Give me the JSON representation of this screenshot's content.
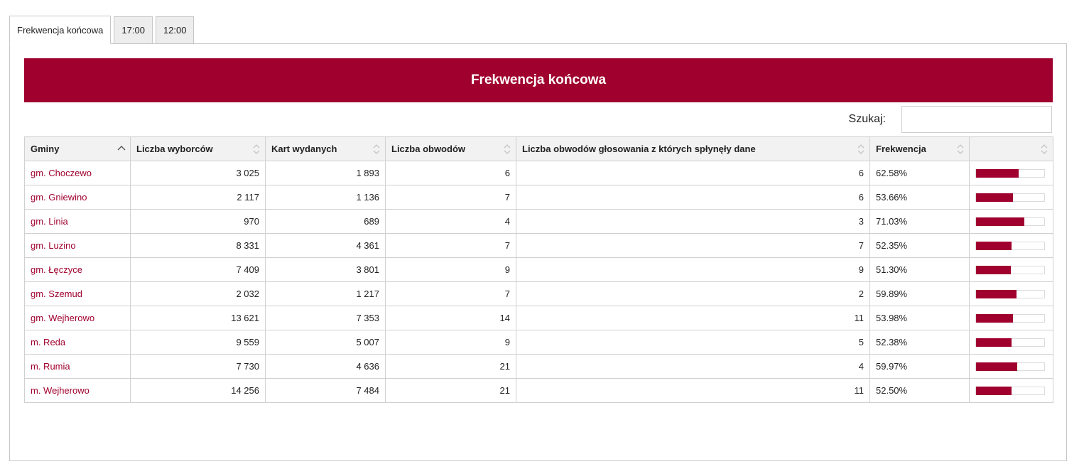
{
  "tabs": [
    {
      "label": "Frekwencja końcowa",
      "active": true
    },
    {
      "label": "17:00",
      "active": false
    },
    {
      "label": "12:00",
      "active": false
    }
  ],
  "banner_title": "Frekwencja końcowa",
  "search": {
    "label": "Szukaj:",
    "value": ""
  },
  "columns": [
    "Gminy",
    "Liczba wyborców",
    "Kart wydanych",
    "Liczba obwodów",
    "Liczba obwodów głosowania z których spłynęły dane",
    "Frekwencja",
    ""
  ],
  "sort": {
    "column": 0,
    "direction": "asc"
  },
  "colors": {
    "accent": "#a0002e",
    "header_bg": "#f2f2f2",
    "border": "#d0d0d0"
  },
  "rows": [
    {
      "name": "gm. Choczewo",
      "voters": "3 025",
      "cards": "1 893",
      "districts": "6",
      "reported": "6",
      "turnout": "62.58%",
      "turnout_value": 62.58
    },
    {
      "name": "gm. Gniewino",
      "voters": "2 117",
      "cards": "1 136",
      "districts": "7",
      "reported": "6",
      "turnout": "53.66%",
      "turnout_value": 53.66
    },
    {
      "name": "gm. Linia",
      "voters": "970",
      "cards": "689",
      "districts": "4",
      "reported": "3",
      "turnout": "71.03%",
      "turnout_value": 71.03
    },
    {
      "name": "gm. Luzino",
      "voters": "8 331",
      "cards": "4 361",
      "districts": "7",
      "reported": "7",
      "turnout": "52.35%",
      "turnout_value": 52.35
    },
    {
      "name": "gm. Łęczyce",
      "voters": "7 409",
      "cards": "3 801",
      "districts": "9",
      "reported": "9",
      "turnout": "51.30%",
      "turnout_value": 51.3
    },
    {
      "name": "gm. Szemud",
      "voters": "2 032",
      "cards": "1 217",
      "districts": "7",
      "reported": "2",
      "turnout": "59.89%",
      "turnout_value": 59.89
    },
    {
      "name": "gm. Wejherowo",
      "voters": "13 621",
      "cards": "7 353",
      "districts": "14",
      "reported": "11",
      "turnout": "53.98%",
      "turnout_value": 53.98
    },
    {
      "name": "m. Reda",
      "voters": "9 559",
      "cards": "5 007",
      "districts": "9",
      "reported": "5",
      "turnout": "52.38%",
      "turnout_value": 52.38
    },
    {
      "name": "m. Rumia",
      "voters": "7 730",
      "cards": "4 636",
      "districts": "21",
      "reported": "4",
      "turnout": "59.97%",
      "turnout_value": 59.97
    },
    {
      "name": "m. Wejherowo",
      "voters": "14 256",
      "cards": "7 484",
      "districts": "21",
      "reported": "11",
      "turnout": "52.50%",
      "turnout_value": 52.5
    }
  ]
}
